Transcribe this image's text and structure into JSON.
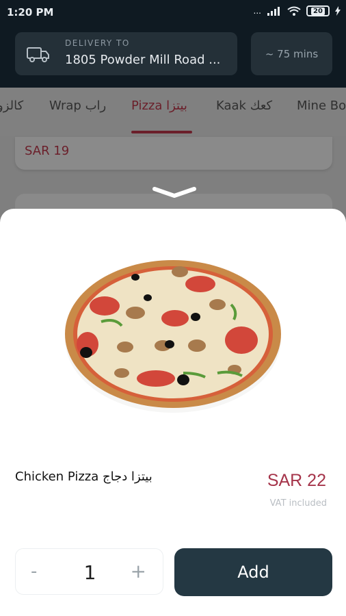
{
  "status_bar": {
    "time": "1:20 PM",
    "signal": "...",
    "battery": "20"
  },
  "header": {
    "delivery_label": "DELIVERY TO",
    "address": "1805 Powder Mill Road ...",
    "eta": "~ 75 mins"
  },
  "tabs": [
    {
      "label": "كالزو"
    },
    {
      "label": "Wrap راب"
    },
    {
      "label": "Pizza بيتزا"
    },
    {
      "label": "Kaak كعك"
    },
    {
      "label": "Mine Bo"
    }
  ],
  "background_item": {
    "price": "SAR 19"
  },
  "item": {
    "name": "Chicken Pizza بيتزا دجاج",
    "price": "SAR 22",
    "vat_note": "VAT included"
  },
  "quantity": {
    "minus": "-",
    "value": "1",
    "plus": "+"
  },
  "actions": {
    "add_label": "Add"
  },
  "colors": {
    "accent": "#a5344a",
    "button": "#243843",
    "header": "#0f1a22"
  }
}
